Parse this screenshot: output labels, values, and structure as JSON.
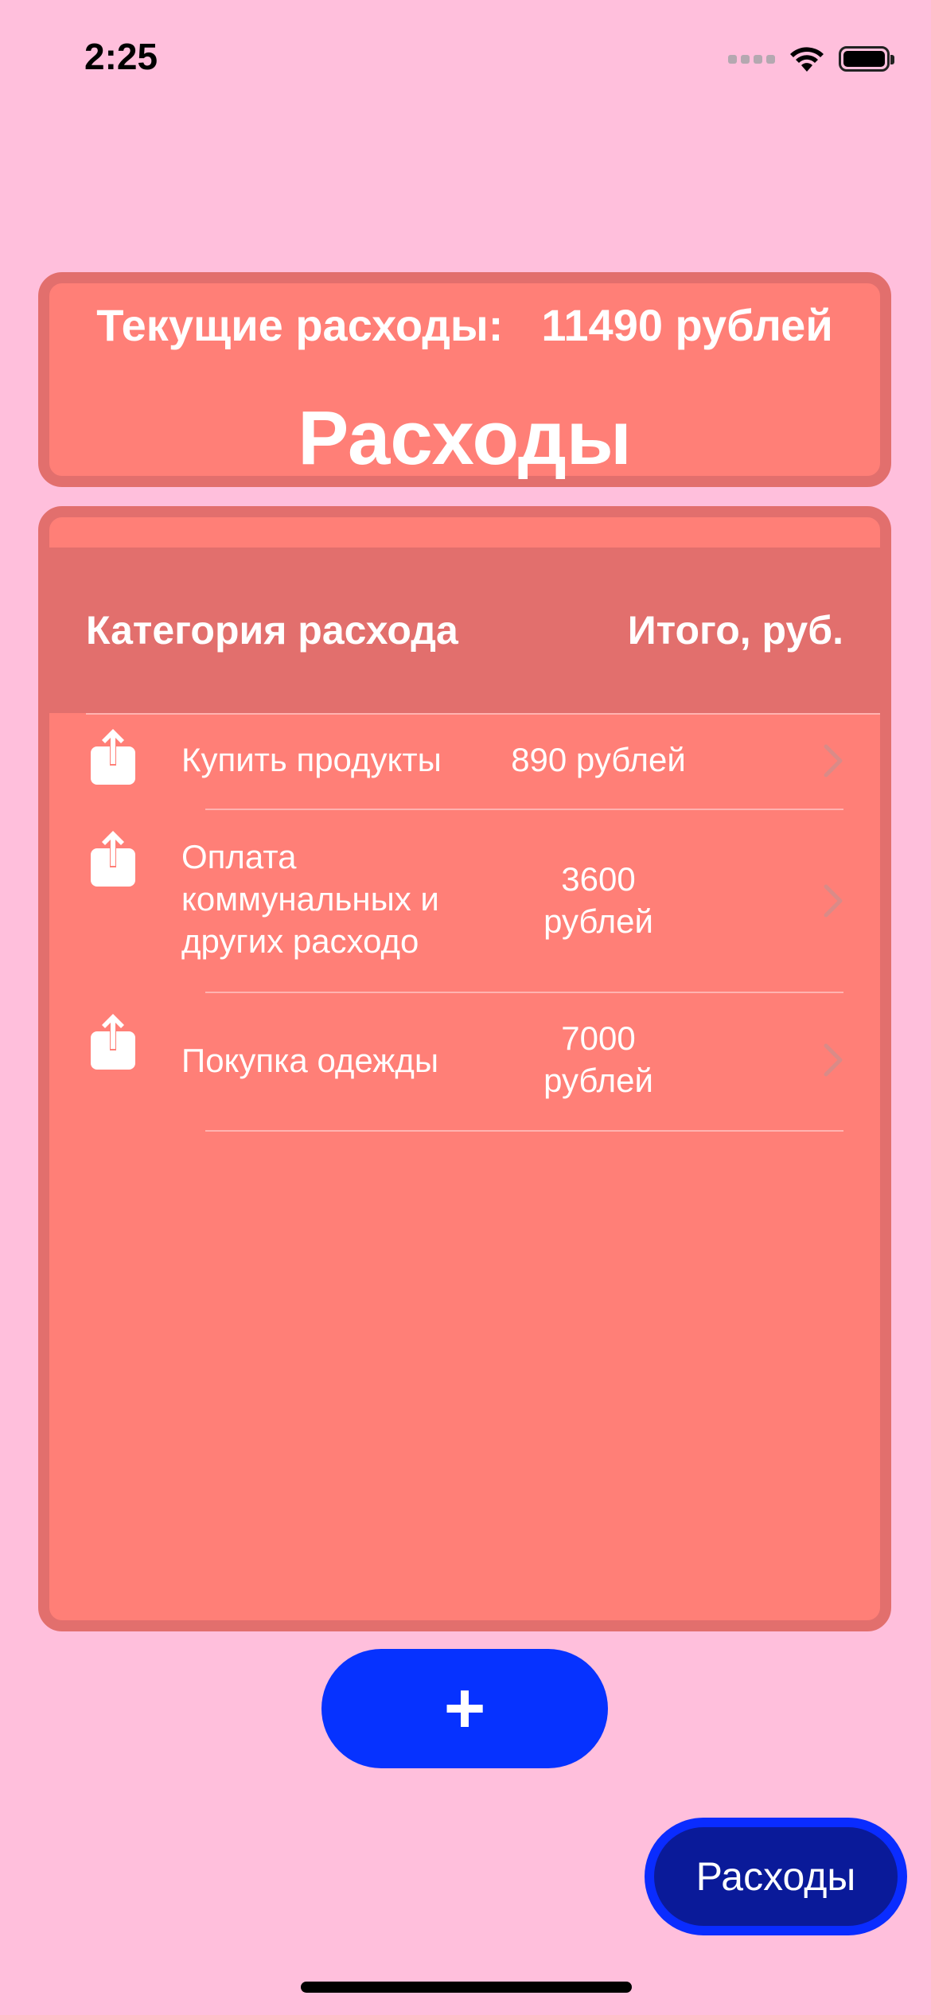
{
  "status_bar": {
    "time": "2:25"
  },
  "summary": {
    "current_label": "Текущие расходы:",
    "current_value": "11490 рублей",
    "title": "Расходы"
  },
  "table": {
    "col_category": "Категория расхода",
    "col_total": "Итого, руб.",
    "rows": [
      {
        "label": "Купить продукты",
        "amount": "890 рублей",
        "icon": "share-icon"
      },
      {
        "label": "Оплата коммунальных и других расходо",
        "amount": "3600 рублей",
        "icon": "share-icon"
      },
      {
        "label": "Покупка одежды",
        "amount": "7000 рублей",
        "icon": "share-icon"
      }
    ]
  },
  "add_button": {
    "label": "+"
  },
  "tab_button": {
    "label": "Расходы"
  },
  "colors": {
    "background": "#FFBFDC",
    "card": "#FF7F77",
    "card_border": "#E26F6D",
    "primary_button": "#0632FF",
    "tab_button": "#0A1A99"
  }
}
